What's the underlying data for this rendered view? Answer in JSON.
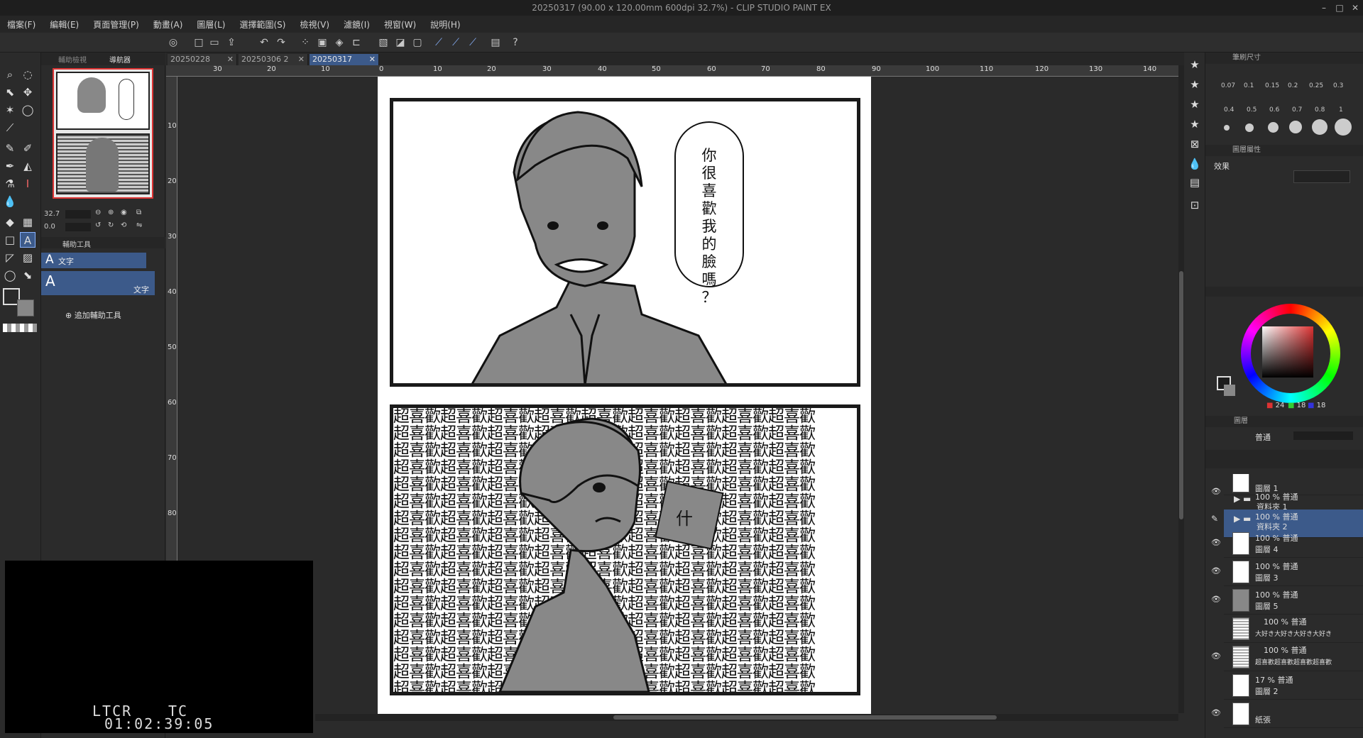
{
  "window": {
    "title": "20250317 (90.00 x 120.00mm 600dpi 32.7%) - CLIP STUDIO PAINT EX"
  },
  "menu": [
    "檔案(F)",
    "編輯(E)",
    "頁面管理(P)",
    "動畫(A)",
    "圖層(L)",
    "選擇範圍(S)",
    "檢視(V)",
    "濾鏡(I)",
    "視窗(W)",
    "說明(H)"
  ],
  "nav_tabs": {
    "sub_view": "輔助檢視",
    "navigator": "導航器"
  },
  "navigator": {
    "zoom": "32.7",
    "rotation": "0.0"
  },
  "sub_tool": {
    "tab_label": "輔助工具",
    "item1": "文字",
    "item2": "文字",
    "add_label": "追加輔助工具"
  },
  "doc_tabs": [
    "20250228",
    "20250306 2",
    "20250317"
  ],
  "ruler_h": [
    "30",
    "20",
    "10",
    "0",
    "10",
    "20",
    "30",
    "40",
    "50",
    "60",
    "70",
    "80",
    "90",
    "100",
    "110",
    "120",
    "130",
    "140"
  ],
  "ruler_v": [
    "10",
    "20",
    "30",
    "40",
    "50",
    "60",
    "70",
    "80"
  ],
  "comic": {
    "bubble1": [
      "你",
      "很",
      "喜",
      "歡",
      "我",
      "的",
      "臉",
      "嗎",
      "？"
    ],
    "bubble2": "什",
    "bg_text": "超喜歡超喜歡超喜歡超喜歡超喜歡超喜歡超喜歡超喜歡超喜歡"
  },
  "brush_size": {
    "header": "筆刷尺寸",
    "sizes_row1": [
      "0.07",
      "0.1",
      "0.15",
      "0.2",
      "0.25",
      "0.3"
    ],
    "sizes_row2": [
      "0.4",
      "0.5",
      "0.6",
      "0.7",
      "0.8",
      "1"
    ]
  },
  "layer_property": {
    "header": "圖層屬性",
    "effect_label": "效果"
  },
  "color": {
    "r": "24",
    "g": "18",
    "b": "18",
    "accent": "#3c5a8a"
  },
  "layers_panel": {
    "header": "圖層",
    "blend": "普通",
    "layers": [
      {
        "mode": "",
        "name": "圖層 1"
      },
      {
        "mode": "100 % 普通",
        "name": "資料夾 1"
      },
      {
        "mode": "100 % 普通",
        "name": "資料夾 2"
      },
      {
        "mode": "100 % 普通",
        "name": "圖層 4"
      },
      {
        "mode": "100 % 普通",
        "name": "圖層 3"
      },
      {
        "mode": "100 % 普通",
        "name": "圖層 5"
      },
      {
        "mode": "100 % 普通",
        "name": "大好き大好き大好き大好き"
      },
      {
        "mode": "100 % 普通",
        "name": "超喜歡超喜歡超喜歡超喜歡"
      },
      {
        "mode": "17 % 普通",
        "name": "圖層 2"
      },
      {
        "mode": "",
        "name": "紙張"
      }
    ]
  },
  "video_overlay": {
    "ltcr": "LTCR",
    "tc": "TC",
    "timecode": "01:02:39:05"
  }
}
